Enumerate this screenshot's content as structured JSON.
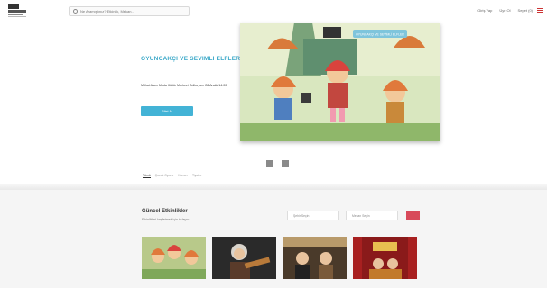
{
  "header": {
    "search_placeholder": "Ne Aramıştınız? Etkinlik, Mekan..",
    "nav": [
      "Giriş Yap",
      "Üye Ol",
      "Sepet (0)"
    ]
  },
  "hero": {
    "title": "Oyuncakçı ve Sevimli Elfler",
    "subtitle": "Mithat Alam Moda Kültür Merkezi Oditoryum 28 Aralık 14:00",
    "button_label": "Bilet Al",
    "poster_badge": "OYUNCAKÇI VE SEVİMLİ ELFLER"
  },
  "tabs": [
    "Tümü",
    "Çocuk Oyunu",
    "Konser",
    "Tiyatro"
  ],
  "events": {
    "title": "Güncel Etkinlikler",
    "subtitle": "Etkinlikleri keşfetmek için tıklayın",
    "filter_city": "Şehir Seçin",
    "filter_venue": "Mekan Seçin"
  },
  "cards": [
    {
      "caption": ""
    },
    {
      "caption": ""
    },
    {
      "caption": ""
    },
    {
      "caption": ""
    }
  ],
  "colors": {
    "accent": "#43b3d6",
    "filter_button": "#d84a5a",
    "title_text": "#3aa8c8"
  },
  "icons": [
    "search-icon",
    "menu-icon",
    "chevron-left-icon",
    "chevron-right-icon"
  ]
}
